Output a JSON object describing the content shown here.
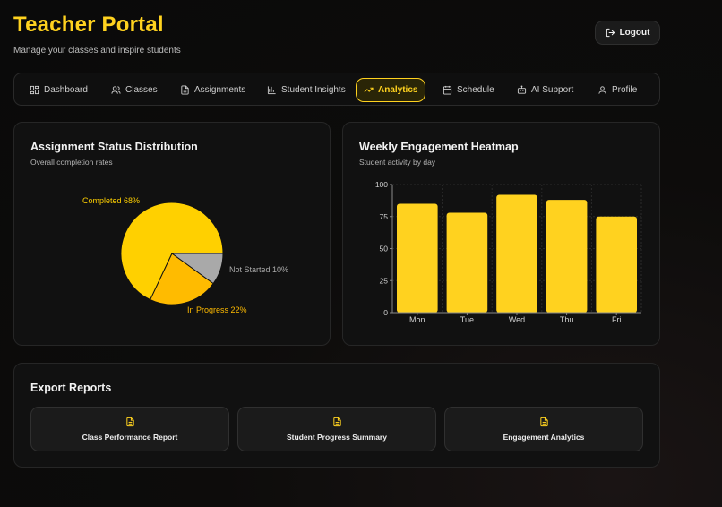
{
  "header": {
    "title": "Teacher Portal",
    "subtitle": "Manage your classes and inspire students",
    "logout_label": "Logout"
  },
  "nav": {
    "tabs": [
      {
        "label": "Dashboard",
        "icon": "dashboard-icon",
        "active": false
      },
      {
        "label": "Classes",
        "icon": "users-icon",
        "active": false
      },
      {
        "label": "Assignments",
        "icon": "document-icon",
        "active": false
      },
      {
        "label": "Student Insights",
        "icon": "bar-chart-icon",
        "active": false
      },
      {
        "label": "Analytics",
        "icon": "trending-up-icon",
        "active": true
      },
      {
        "label": "Schedule",
        "icon": "calendar-icon",
        "active": false
      },
      {
        "label": "AI Support",
        "icon": "bot-icon",
        "active": false
      },
      {
        "label": "Profile",
        "icon": "user-icon",
        "active": false
      }
    ]
  },
  "pie_card": {
    "title": "Assignment Status Distribution",
    "subtitle": "Overall completion rates"
  },
  "bar_card": {
    "title": "Weekly Engagement Heatmap",
    "subtitle": "Student activity by day"
  },
  "export": {
    "title": "Export Reports",
    "buttons": [
      {
        "label": "Class Performance Report"
      },
      {
        "label": "Student Progress Summary"
      },
      {
        "label": "Engagement Analytics"
      }
    ]
  },
  "colors": {
    "accent": "#ffd21f",
    "completed": "#ffd000",
    "in_progress": "#ffbb00",
    "not_started": "#a9a9a9"
  },
  "chart_data": [
    {
      "type": "pie",
      "labels": [
        "Completed 68%",
        "In Progress 22%",
        "Not Started 10%"
      ],
      "categories": [
        "Completed",
        "In Progress",
        "Not Started"
      ],
      "values": [
        68,
        22,
        10
      ]
    },
    {
      "type": "bar",
      "categories": [
        "Mon",
        "Tue",
        "Wed",
        "Thu",
        "Fri"
      ],
      "values": [
        85,
        78,
        92,
        88,
        75
      ],
      "ylim": [
        0,
        100
      ],
      "yticks": [
        0,
        25,
        50,
        75,
        100
      ],
      "grid": true
    }
  ]
}
